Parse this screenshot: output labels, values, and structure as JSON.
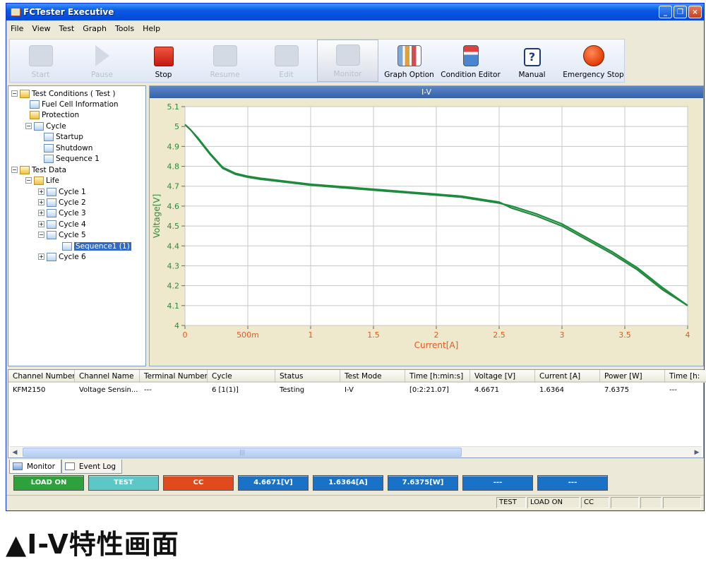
{
  "window": {
    "title": "FCTester Executive",
    "minimize": "_",
    "restore": "❐",
    "close": "×"
  },
  "menu": [
    "File",
    "View",
    "Test",
    "Graph",
    "Tools",
    "Help"
  ],
  "toolbar": [
    {
      "label": "Start",
      "icon": "folder-icon",
      "enabled": false
    },
    {
      "label": "Pause",
      "icon": "play-icon",
      "enabled": false
    },
    {
      "label": "Stop",
      "icon": "stop-icon",
      "enabled": true,
      "color": "#d42a1a"
    },
    {
      "label": "Resume",
      "icon": "key-icon",
      "enabled": false
    },
    {
      "label": "Edit",
      "icon": "document-icon",
      "enabled": false
    },
    {
      "label": "Monitor",
      "icon": "monitor-icon",
      "enabled": false,
      "selected": true
    },
    {
      "label": "Graph Option",
      "icon": "bar-chart-icon",
      "enabled": true
    },
    {
      "label": "Condition Editor",
      "icon": "battery-icon",
      "enabled": true
    },
    {
      "label": "Manual",
      "icon": "help-icon",
      "enabled": true
    },
    {
      "label": "Emergency Stop",
      "icon": "emergency-stop-icon",
      "enabled": true,
      "color": "#ea4a12"
    }
  ],
  "tree": {
    "root1": "Test Conditions ( Test )",
    "fuel_cell": "Fuel Cell Information",
    "protection": "Protection",
    "cycle": "Cycle",
    "startup": "Startup",
    "shutdown": "Shutdown",
    "sequence": "Sequence 1",
    "root2": "Test Data",
    "life": "Life",
    "cycles": [
      "Cycle 1",
      "Cycle 2",
      "Cycle 3",
      "Cycle 4",
      "Cycle 5"
    ],
    "selected": "Sequence1 (1)",
    "cycle6": "Cycle 6"
  },
  "chart_data": {
    "type": "line",
    "title": "I-V",
    "xlabel": "Current[A]",
    "ylabel": "Voltage[V]",
    "xlim": [
      0,
      4
    ],
    "ylim": [
      4,
      5.1
    ],
    "x_ticks": [
      0,
      0.5,
      1,
      1.5,
      2,
      2.5,
      3,
      3.5,
      4
    ],
    "x_tick_labels": [
      "0",
      "500m",
      "1",
      "1.5",
      "2",
      "2.5",
      "3",
      "3.5",
      "4"
    ],
    "y_ticks": [
      4,
      4.1,
      4.2,
      4.3,
      4.4,
      4.5,
      4.6,
      4.7,
      4.8,
      4.9,
      5,
      5.1
    ],
    "y_tick_labels": [
      "4",
      "4.1",
      "4.2",
      "4.3",
      "4.4",
      "4.5",
      "4.6",
      "4.7",
      "4.8",
      "4.9",
      "5",
      "5.1"
    ],
    "grid": true,
    "line_color": "#1f8a3c",
    "series": [
      {
        "x": [
          0,
          0.05,
          0.1,
          0.15,
          0.2,
          0.3,
          0.4,
          0.5,
          0.6,
          0.8,
          1.0,
          1.2,
          1.4,
          1.6,
          1.8,
          2.0,
          2.2,
          2.4,
          2.5,
          2.6,
          2.8,
          3.0,
          3.2,
          3.4,
          3.6,
          3.8,
          4.0
        ],
        "y": [
          5.01,
          4.98,
          4.94,
          4.9,
          4.86,
          4.79,
          4.76,
          4.745,
          4.735,
          4.72,
          4.705,
          4.695,
          4.685,
          4.675,
          4.665,
          4.655,
          4.645,
          4.625,
          4.615,
          4.6,
          4.56,
          4.51,
          4.44,
          4.37,
          4.29,
          4.19,
          4.1
        ]
      },
      {
        "x": [
          0,
          0.05,
          0.1,
          0.15,
          0.2,
          0.3,
          0.4,
          0.5,
          0.6,
          0.8,
          1.0,
          1.2,
          1.4,
          1.6,
          1.8,
          2.0,
          2.2,
          2.4,
          2.5,
          2.6,
          2.8,
          3.0,
          3.2,
          3.4,
          3.6,
          3.8,
          4.0
        ],
        "y": [
          5.01,
          4.98,
          4.945,
          4.905,
          4.865,
          4.795,
          4.765,
          4.75,
          4.74,
          4.725,
          4.71,
          4.7,
          4.69,
          4.68,
          4.67,
          4.66,
          4.65,
          4.63,
          4.62,
          4.59,
          4.55,
          4.5,
          4.43,
          4.36,
          4.28,
          4.18,
          4.1
        ]
      }
    ]
  },
  "grid": {
    "columns": [
      "Channel Number",
      "Channel Name",
      "Terminal Number",
      "Cycle",
      "Status",
      "Test Mode",
      "Time [h:min:s]",
      "Voltage [V]",
      "Current [A]",
      "Power [W]",
      "Time [h:"
    ],
    "rows": [
      [
        "KFM2150",
        "Voltage Sensin...",
        "---",
        "6 [1(1)]",
        "Testing",
        "I-V",
        "[0:2:21.07]",
        "4.6671",
        "1.6364",
        "7.6375",
        "---"
      ]
    ]
  },
  "tabs": [
    "Monitor",
    "Event Log"
  ],
  "status_buttons": [
    {
      "label": "LOAD ON",
      "color": "#2ca13c"
    },
    {
      "label": "TEST",
      "color": "#5cc7c6"
    },
    {
      "label": "CC",
      "color": "#e04a1c"
    },
    {
      "label": "4.6671[V]",
      "color": "#1a72c8"
    },
    {
      "label": "1.6364[A]",
      "color": "#1a72c8"
    },
    {
      "label": "7.6375[W]",
      "color": "#1a72c8"
    },
    {
      "label": "---",
      "color": "#1a72c8"
    },
    {
      "label": "---",
      "color": "#1a72c8"
    }
  ],
  "statusbar": [
    "TEST",
    "LOAD ON",
    "CC"
  ],
  "caption": "▲I-V特性画面"
}
